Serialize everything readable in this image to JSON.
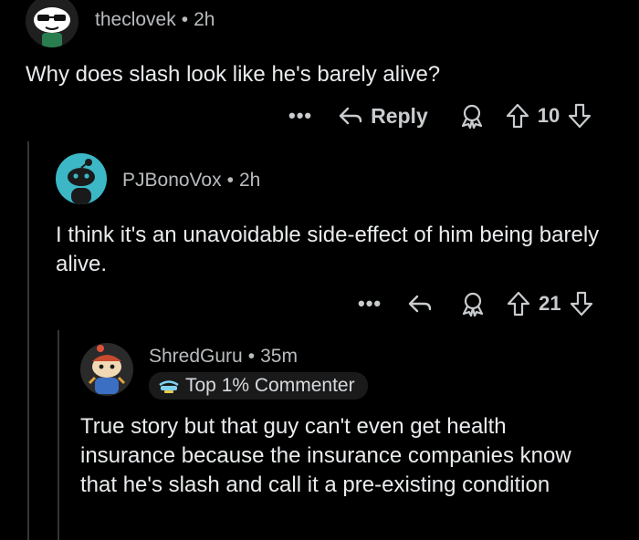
{
  "comments": [
    {
      "username": "theclovek",
      "age": "2h",
      "text": "Why does slash look like he's barely alive?",
      "reply_label": "Reply",
      "score": "10",
      "more": "•••"
    },
    {
      "username": "PJBonoVox",
      "age": "2h",
      "text": "I think it's an unavoidable side-effect of him being barely alive.",
      "score": "21",
      "more": "•••"
    },
    {
      "username": "ShredGuru",
      "age": "35m",
      "badge": "Top 1% Commenter",
      "text": "True story but that guy can't even get health insurance because the insurance companies know that he's slash and call it a pre-existing condition"
    }
  ],
  "separator": "•",
  "colors": {
    "background": "#000000",
    "thread_line": "#343536",
    "snoo_avatar_bg": "#3cb7c6",
    "text": "#e9ebed",
    "meta": "#b9bcbe"
  }
}
